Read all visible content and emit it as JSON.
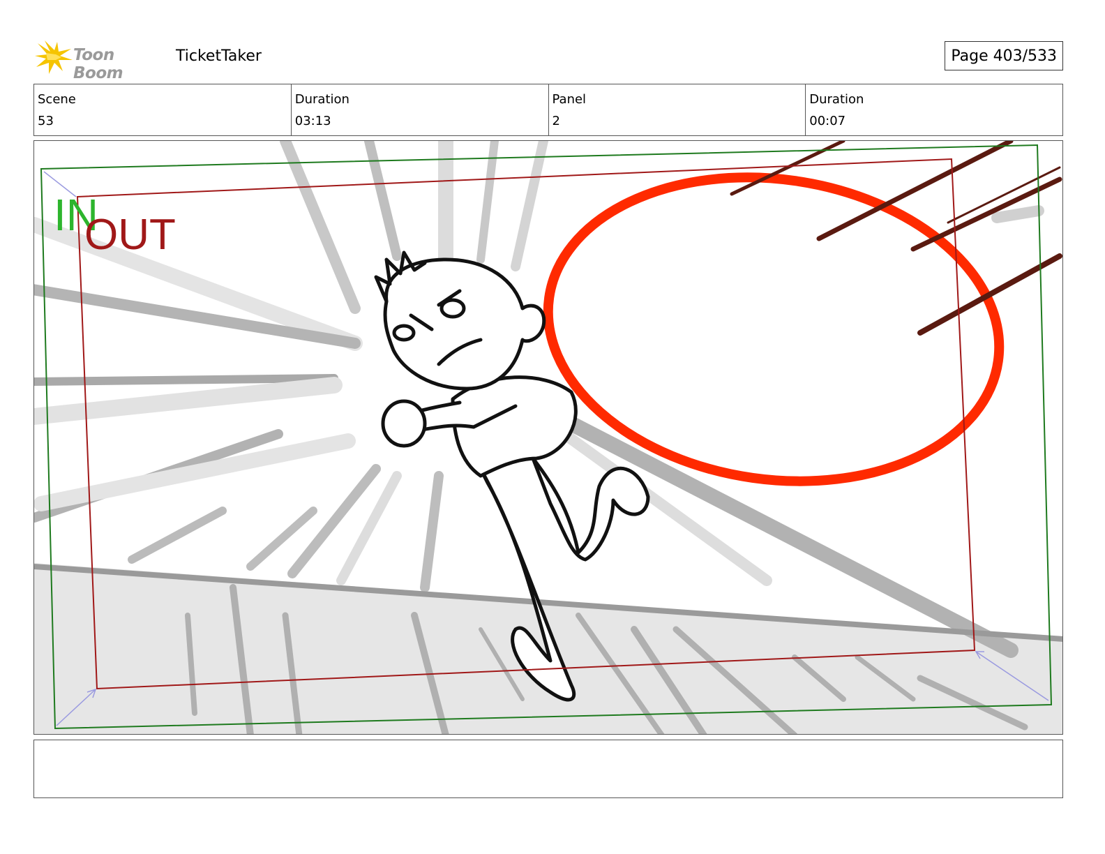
{
  "header": {
    "logo_text": "Toon Boom",
    "project_title": "TicketTaker",
    "page_label": "Page 403/533"
  },
  "info": {
    "scene_label": "Scene",
    "scene_value": "53",
    "scene_duration_label": "Duration",
    "scene_duration_value": "03:13",
    "panel_label": "Panel",
    "panel_value": "2",
    "panel_duration_label": "Duration",
    "panel_duration_value": "00:07"
  },
  "panel": {
    "in_label": "IN",
    "out_label": "OUT"
  },
  "notes": {
    "text": ""
  },
  "colors": {
    "in_frame": "#1e7a1e",
    "out_frame": "#a01818",
    "in_text": "#2db52d",
    "out_text": "#a01818",
    "red_ring": "#ff2a00",
    "speed_lines_dark": "#5a1a10",
    "logo_star": "#f5c400",
    "logo_text": "#9a9a9a"
  },
  "icons": {
    "logo": "toon-boom-star-icon"
  }
}
